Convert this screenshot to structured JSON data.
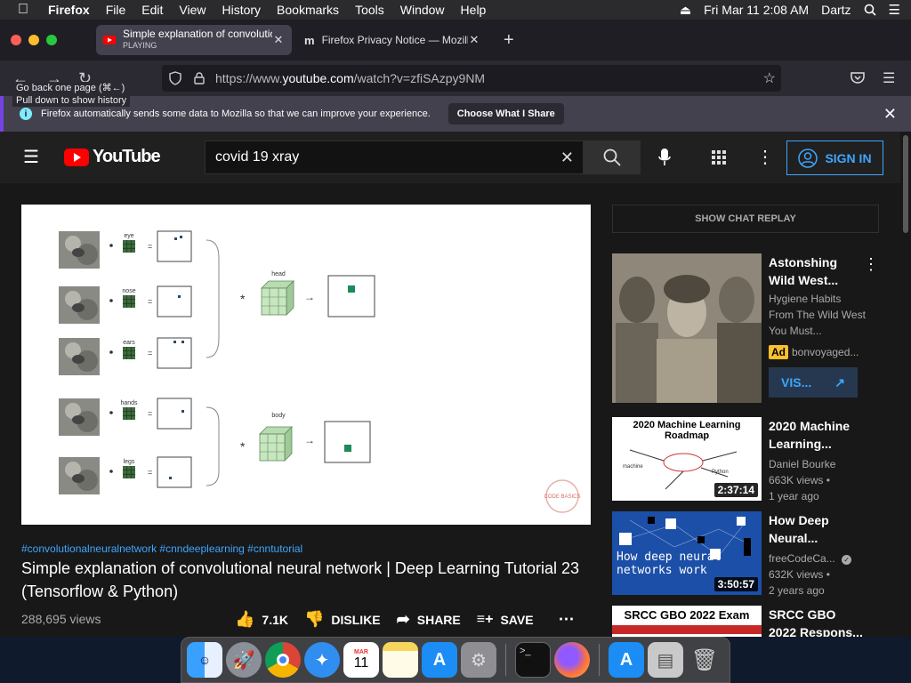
{
  "menubar": {
    "app": "Firefox",
    "items": [
      "File",
      "Edit",
      "View",
      "History",
      "Bookmarks",
      "Tools",
      "Window",
      "Help"
    ],
    "datetime": "Fri Mar 11  2:08 AM",
    "user": "Dartz"
  },
  "tabs": [
    {
      "title": "Simple explanation of convolutio",
      "status": "PLAYING"
    },
    {
      "title": "Firefox Privacy Notice — Mozilla"
    }
  ],
  "url": {
    "prefix": "https://www.",
    "domain": "youtube.com",
    "path": "/watch?v=zfiSAzpy9NM"
  },
  "tooltip": {
    "line1": "Go back one page (⌘←)",
    "line2": "Pull down to show history"
  },
  "infobar": {
    "text": "Firefox automatically sends some data to Mozilla so that we can improve your experience.",
    "button": "Choose What I Share"
  },
  "youtube": {
    "logo": "YouTube",
    "search_value": "covid 19 xray",
    "signin": "SIGN IN",
    "tags": "#convolutionalneuralnetwork #cnndeeplearning #cnntutorial",
    "title": "Simple explanation of convolutional neural network | Deep Learning Tutorial 23 (Tensorflow & Python)",
    "views": "288,695 views",
    "likes": "7.1K",
    "dislike": "DISLIKE",
    "share": "SHARE",
    "save": "SAVE",
    "chat_replay": "SHOW CHAT REPLAY",
    "slide": {
      "features": [
        "eye",
        "nose",
        "ears",
        "hands",
        "legs"
      ],
      "groups": [
        "head",
        "body"
      ],
      "watermark": "CODE BASICS"
    },
    "recs": [
      {
        "title": "Astonshing Wild West...",
        "desc": "Hygiene Habits From The Wild West You Must...",
        "ad": "Ad",
        "channel": "bonvoyaged...",
        "cta": "VIS..."
      },
      {
        "title": "2020 Machine Learning...",
        "thumb_text": "2020 Machine Learning Roadmap",
        "channel": "Daniel Bourke",
        "views": "663K views •",
        "age": "1 year ago",
        "duration": "2:37:14"
      },
      {
        "title": "How Deep Neural...",
        "thumb_text": "How deep neural networks work",
        "channel": "freeCodeCa...",
        "views": "632K views •",
        "age": "2 years ago",
        "duration": "3:50:57"
      },
      {
        "title": "SRCC GBO 2022 Respons...",
        "thumb_text": "SRCC GBO 2022 Exam"
      }
    ]
  },
  "dock_icons": [
    "finder-icon",
    "launchpad-icon",
    "chrome-icon",
    "safari-icon",
    "calendar-icon",
    "notes-icon",
    "app-store-icon",
    "system-preferences-icon",
    "terminal-icon",
    "firefox-icon",
    "app-store-icon",
    "preview-icon",
    "trash-icon"
  ],
  "calendar": {
    "month": "MAR",
    "day": "11"
  }
}
